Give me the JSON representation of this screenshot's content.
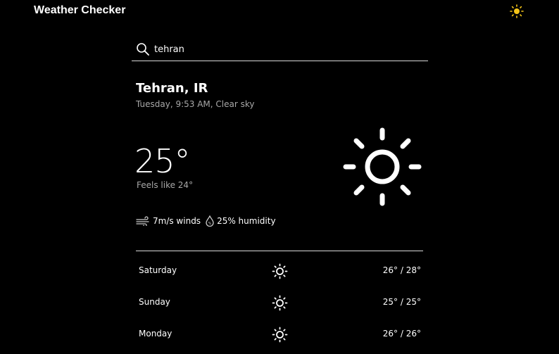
{
  "header": {
    "title": "Weather Checker",
    "theme_icon": "sun-icon",
    "theme_icon_color": "#f5c518"
  },
  "search": {
    "value": "tehran",
    "placeholder": "",
    "icon": "search-icon"
  },
  "current": {
    "city": "Tehran, IR",
    "subline": "Tuesday, 9:53 AM, Clear sky",
    "temperature": "25°",
    "feels_like": "Feels like 24°",
    "condition_icon": "sun-icon",
    "wind": "7m/s winds",
    "wind_icon": "wind-icon",
    "humidity": "25% humidity",
    "humidity_icon": "humidity-drop-icon"
  },
  "forecast": [
    {
      "day": "Saturday",
      "icon": "sun-icon",
      "range": "26° / 28°"
    },
    {
      "day": "Sunday",
      "icon": "sun-icon",
      "range": "25° / 25°"
    },
    {
      "day": "Monday",
      "icon": "sun-icon",
      "range": "26° / 26°"
    }
  ],
  "colors": {
    "background": "#000000",
    "text": "#ffffff",
    "muted_text": "#a8a8a8",
    "accent": "#f5c518"
  }
}
